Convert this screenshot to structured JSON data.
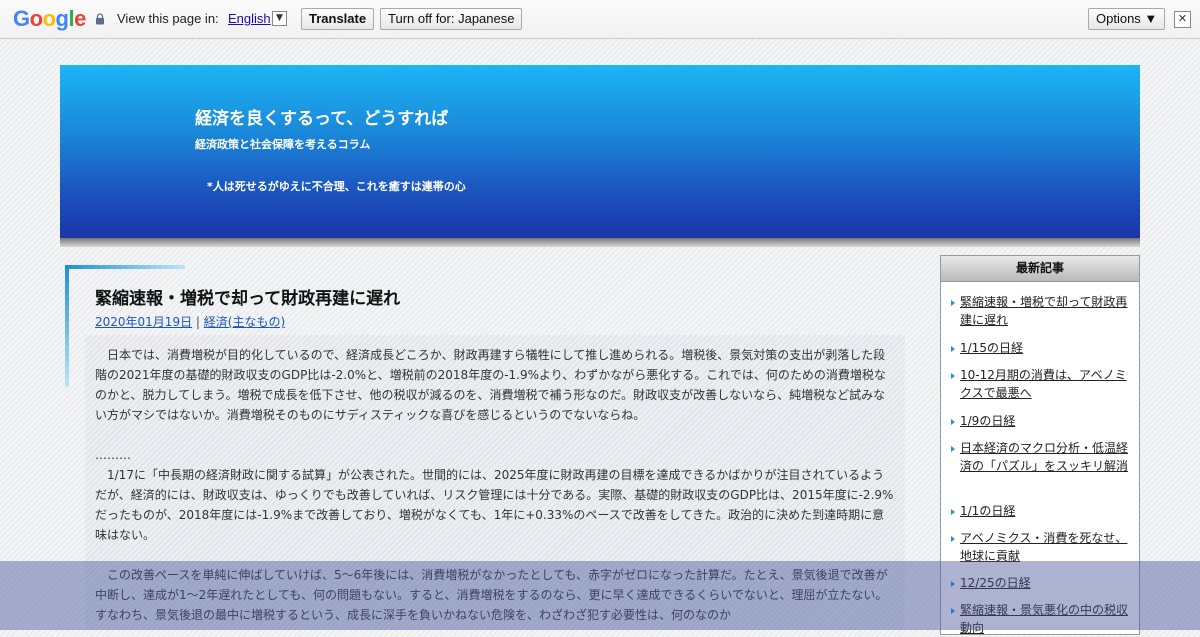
{
  "translate_bar": {
    "logo_letters": [
      "G",
      "o",
      "o",
      "g",
      "l",
      "e"
    ],
    "logo_colors": [
      "#4285f4",
      "#ea4335",
      "#fbbc05",
      "#4285f4",
      "#34a853",
      "#ea4335"
    ],
    "view_label": "View this page in:",
    "language": "English",
    "translate_button": "Translate",
    "turn_off_button": "Turn off for: Japanese",
    "options_button": "Options ▼",
    "close_glyph": "✕"
  },
  "header": {
    "title": "経済を良くするって、どうすれば",
    "description": "経済政策と社会保障を考えるコラム",
    "motto": "*人は死せるがゆえに不合理、これを癒すは連帯の心"
  },
  "post": {
    "title": "緊縮速報・増税で却って財政再建に遅れ",
    "date": "2020年01月19日",
    "separator": " | ",
    "category": "経済(主なもの)",
    "paragraphs": [
      "　日本では、消費増税が目的化しているので、経済成長どころか、財政再建すら犠牲にして推し進められる。増税後、景気対策の支出が剥落した段階の2021年度の基礎的財政収支のGDP比は-2.0%と、増税前の2018年度の-1.9%より、わずかながら悪化する。これでは、何のための消費増税なのかと、脱力してしまう。増税で成長を低下させ、他の税収が減るのを、消費増税で補う形なのだ。財政収支が改善しないなら、純増税など試みない方がマシではないか。消費増税そのものにサディスティックな喜びを感じるというのでないならね。",
      "………\n　1/17に「中長期の経済財政に関する試算」が公表された。世間的には、2025年度に財政再建の目標を達成できるかばかりが注目されているようだが、経済的には、財政収支は、ゆっくりでも改善していれば、リスク管理には十分である。実際、基礎的財政収支のGDP比は、2015年度に-2.9%だったものが、2018年度には-1.9%まで改善しており、増税がなくても、1年に+0.33%のペースで改善をしてきた。政治的に決めた到達時期に意味はない。",
      "　この改善ペースを単純に伸ばしていけば、5～6年後には、消費増税がなかったとしても、赤字がゼロになった計算だ。たとえ、景気後退で改善が中断し、達成が1～2年遅れたとしても、何の問題もない。すると、消費増税をするのなら、更に早く達成できるくらいでないと、理屈が立たない。すなわち、景気後退の最中に増税するという、成長に深手を負いかねない危険を、わざわざ犯す必要性は、何のなのか"
    ]
  },
  "sidebar": {
    "heading": "最新記事",
    "items": [
      "緊縮速報・増税で却って財政再建に遅れ",
      "1/15の日経",
      "10-12月期の消費は、アベノミクスで最悪へ",
      "1/9の日経",
      "日本経済のマクロ分析・低温経済の「パズル」をスッキリ解消",
      "1/1の日経",
      "アベノミクス・消費を死なせ、地球に貢献",
      "12/25の日経",
      "緊縮速報・景気悪化の中の税収動向"
    ]
  }
}
